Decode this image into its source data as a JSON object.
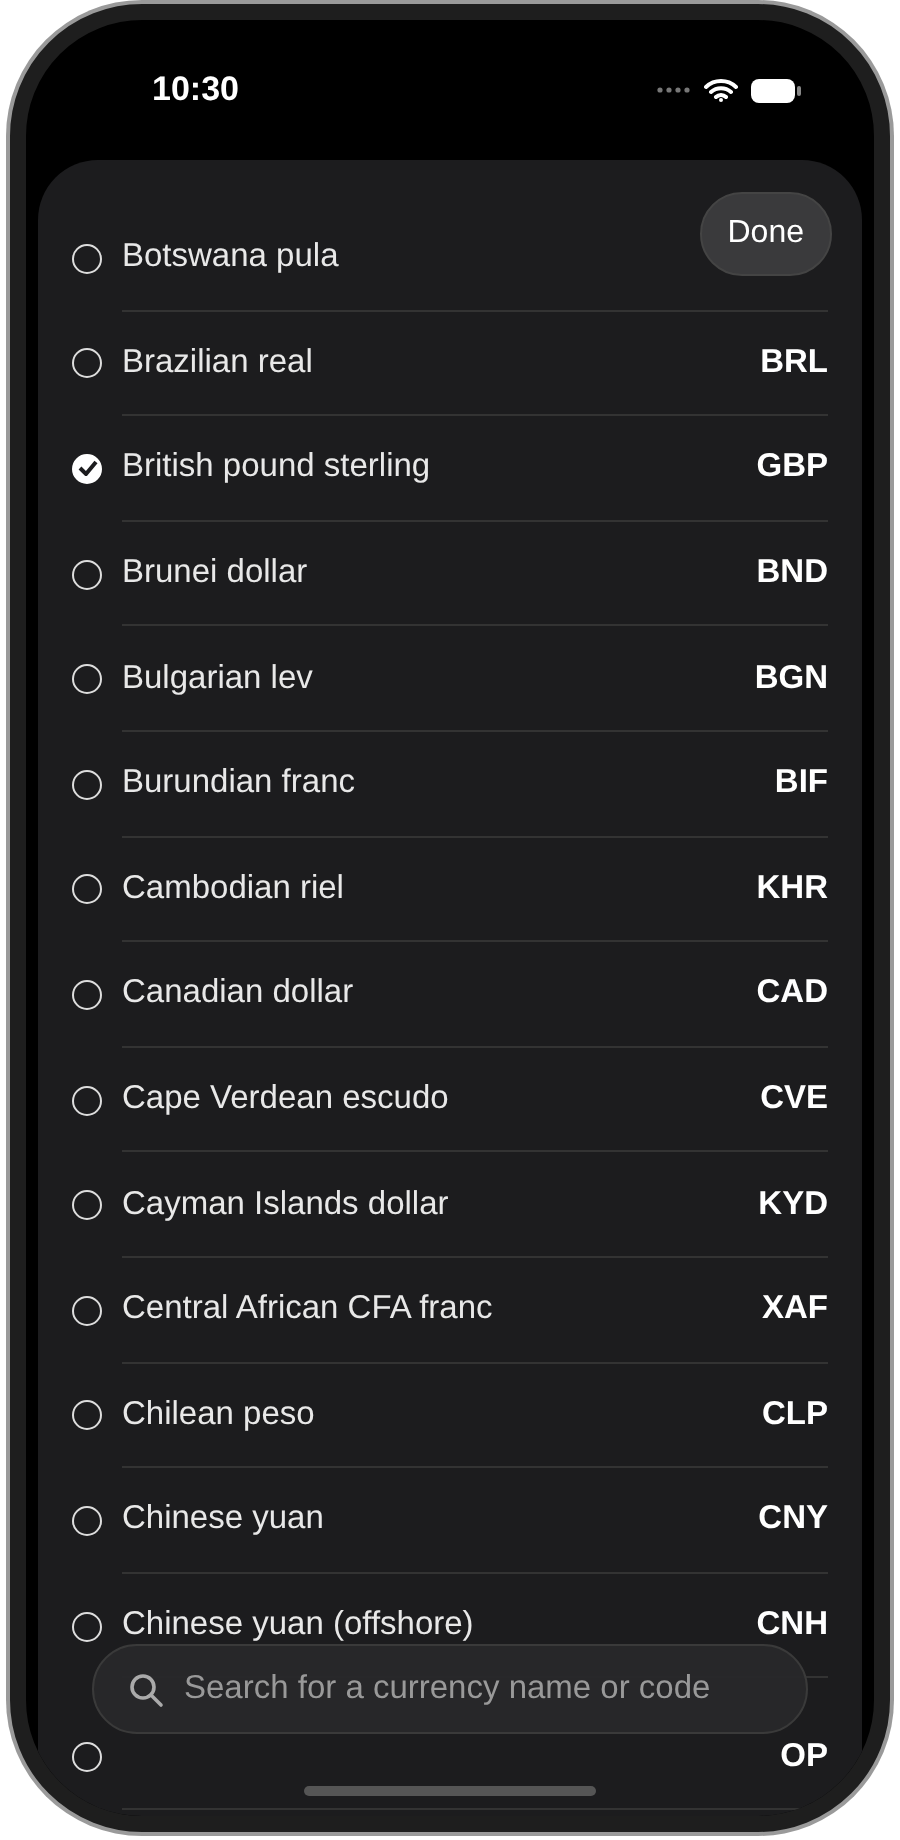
{
  "status_bar": {
    "time": "10:30"
  },
  "done_button": {
    "label": "Done"
  },
  "currencies": [
    {
      "name": "Botswana pula",
      "selected": false
    },
    {
      "name": "Brazilian real",
      "code": "BRL",
      "selected": false
    },
    {
      "name": "British pound sterling",
      "code": "GBP",
      "selected": true
    },
    {
      "name": "Brunei dollar",
      "code": "BND",
      "selected": false
    },
    {
      "name": "Bulgarian lev",
      "code": "BGN",
      "selected": false
    },
    {
      "name": "Burundian franc",
      "code": "BIF",
      "selected": false
    },
    {
      "name": "Cambodian riel",
      "code": "KHR",
      "selected": false
    },
    {
      "name": "Canadian dollar",
      "code": "CAD",
      "selected": false
    },
    {
      "name": "Cape Verdean escudo",
      "code": "CVE",
      "selected": false
    },
    {
      "name": "Cayman Islands dollar",
      "code": "KYD",
      "selected": false
    },
    {
      "name": "Central African CFA franc",
      "code": "XAF",
      "selected": false
    },
    {
      "name": "Chilean peso",
      "code": "CLP",
      "selected": false
    },
    {
      "name": "Chinese yuan",
      "code": "CNY",
      "selected": false
    },
    {
      "name": "Chinese yuan (offshore)",
      "code": "CNH",
      "selected": false
    },
    {
      "code": "OP",
      "selected": false
    }
  ],
  "search": {
    "placeholder": "Search for a currency name or code"
  }
}
